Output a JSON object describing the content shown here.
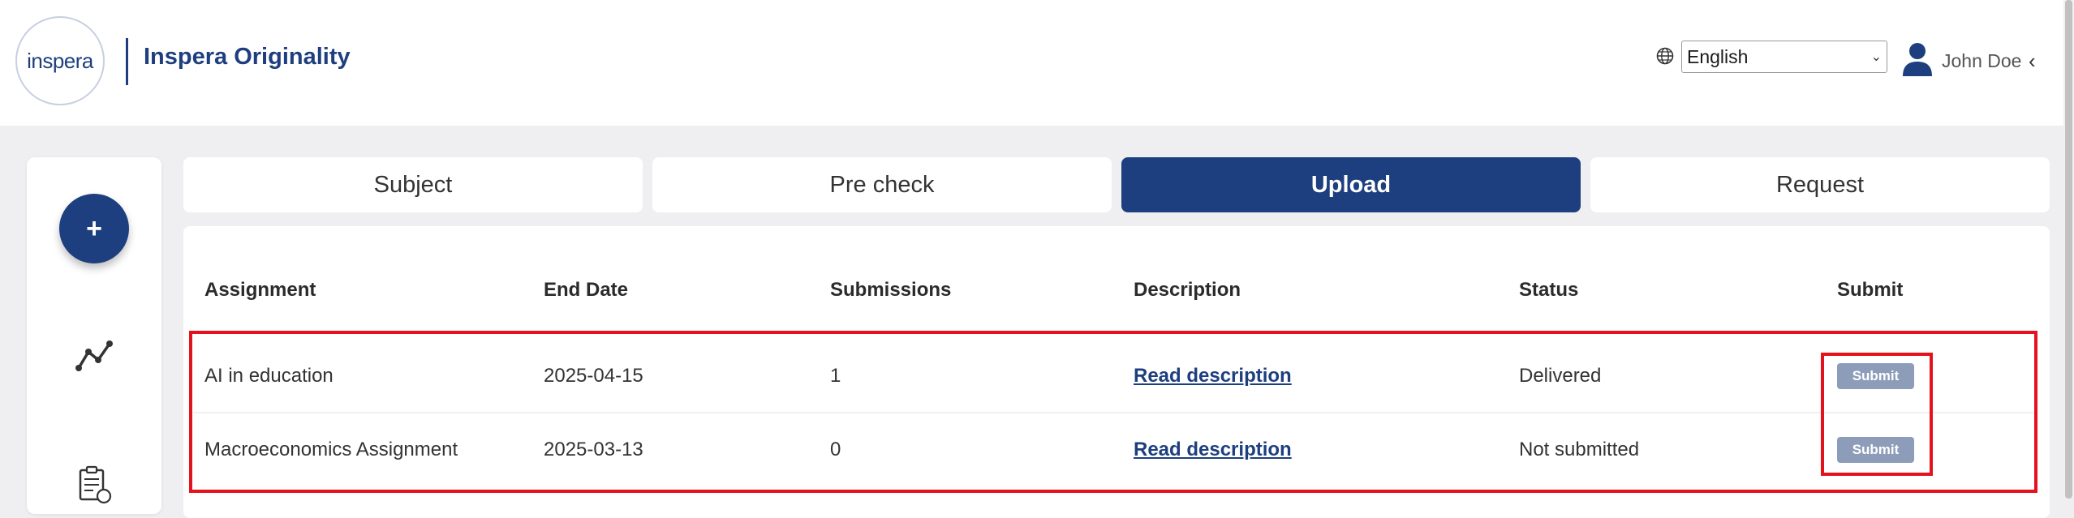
{
  "header": {
    "logo_text": "inspera",
    "app_title": "Inspera Originality",
    "language": {
      "selected": "English",
      "options": [
        "English"
      ]
    },
    "user_name": "John Doe"
  },
  "sidebar": {
    "add_label": "+",
    "icons": [
      "plus-icon",
      "line-chart-icon",
      "document-icon"
    ]
  },
  "tabs": [
    {
      "label": "Subject",
      "active": false
    },
    {
      "label": "Pre check",
      "active": false
    },
    {
      "label": "Upload",
      "active": true
    },
    {
      "label": "Request",
      "active": false
    }
  ],
  "table": {
    "columns": [
      "Assignment",
      "End Date",
      "Submissions",
      "Description",
      "Status",
      "Submit"
    ],
    "rows": [
      {
        "assignment": "AI in education",
        "end_date": "2025-04-15",
        "submissions": "1",
        "description": "Read description",
        "status": "Delivered",
        "submit": "Submit"
      },
      {
        "assignment": "Macroeconomics Assignment",
        "end_date": "2025-03-13",
        "submissions": "0",
        "description": "Read description",
        "status": "Not submitted",
        "submit": "Submit"
      }
    ]
  },
  "colors": {
    "brand": "#1e3f7f",
    "highlight": "#e3121d",
    "submit_button": "#8d9db9",
    "background": "#efeff1"
  }
}
